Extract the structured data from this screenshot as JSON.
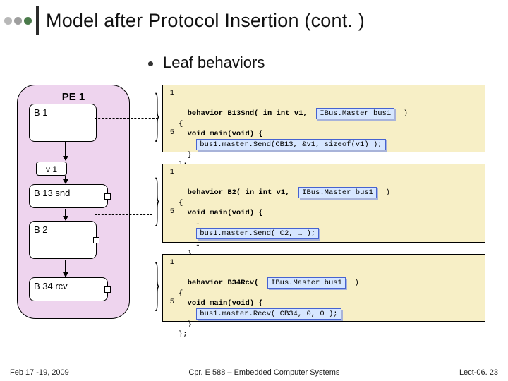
{
  "title": "Model after Protocol Insertion (cont. )",
  "bullet": "Leaf behaviors",
  "pe": {
    "title": "PE 1",
    "b1": "B 1",
    "v1": "v 1",
    "b13snd": "B 13 snd",
    "b2": "B 2",
    "b34rcv": "B 34 rcv"
  },
  "code1": {
    "l1": "behavior B13Snd( in int v1,",
    "hl1": "IBus.Master bus1",
    "tail1": "  )",
    "l2": "{",
    "l3": "  void main(void) {",
    "hl2": "bus1.master.Send(CB13, &v1, sizeof(v1) );",
    "l5": "  }",
    "l6": "};"
  },
  "code2": {
    "l1": "behavior B2( in int v1,",
    "hl1": "IBus.Master bus1",
    "tail1": "  )",
    "l2": "{",
    "l3": "  void main(void) {",
    "l4": "    …",
    "hl2": "bus1.master.Send( C2, … );",
    "l6": "    …",
    "l7": "  }",
    "l8": "};"
  },
  "code3": {
    "l1": "behavior B34Rcv(",
    "hl1": "IBus.Master bus1",
    "tail1": "  )",
    "l2": "{",
    "l3": "  void main(void) {",
    "hl2": "bus1.master.Recv( CB34, 0, 0 );",
    "l5": "  }",
    "l6": "};"
  },
  "footer": {
    "left": "Feb 17 -19, 2009",
    "center": "Cpr. E 588 – Embedded Computer Systems",
    "right": "Lect-06. 23"
  }
}
